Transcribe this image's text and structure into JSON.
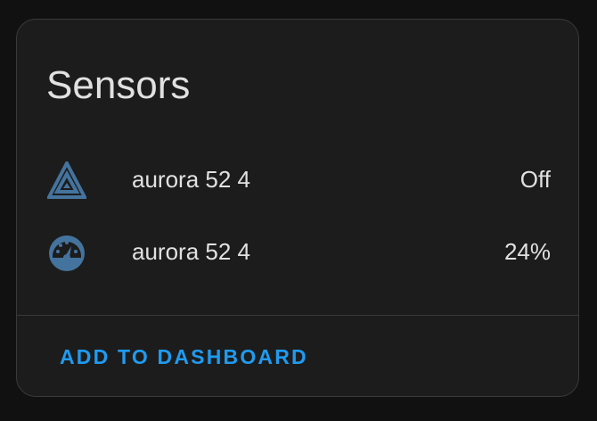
{
  "card": {
    "title": "Sensors",
    "entities": [
      {
        "icon": "home-assistant-triangle-icon",
        "name": "aurora 52 4",
        "state": "Off"
      },
      {
        "icon": "gauge-icon",
        "name": "aurora 52 4",
        "state": "24%"
      }
    ],
    "action_label": "ADD TO DASHBOARD"
  },
  "colors": {
    "background": "#111111",
    "card": "#1c1c1c",
    "icon": "#44739e",
    "text": "#e1e1e1",
    "accent": "#1f9bf0"
  }
}
